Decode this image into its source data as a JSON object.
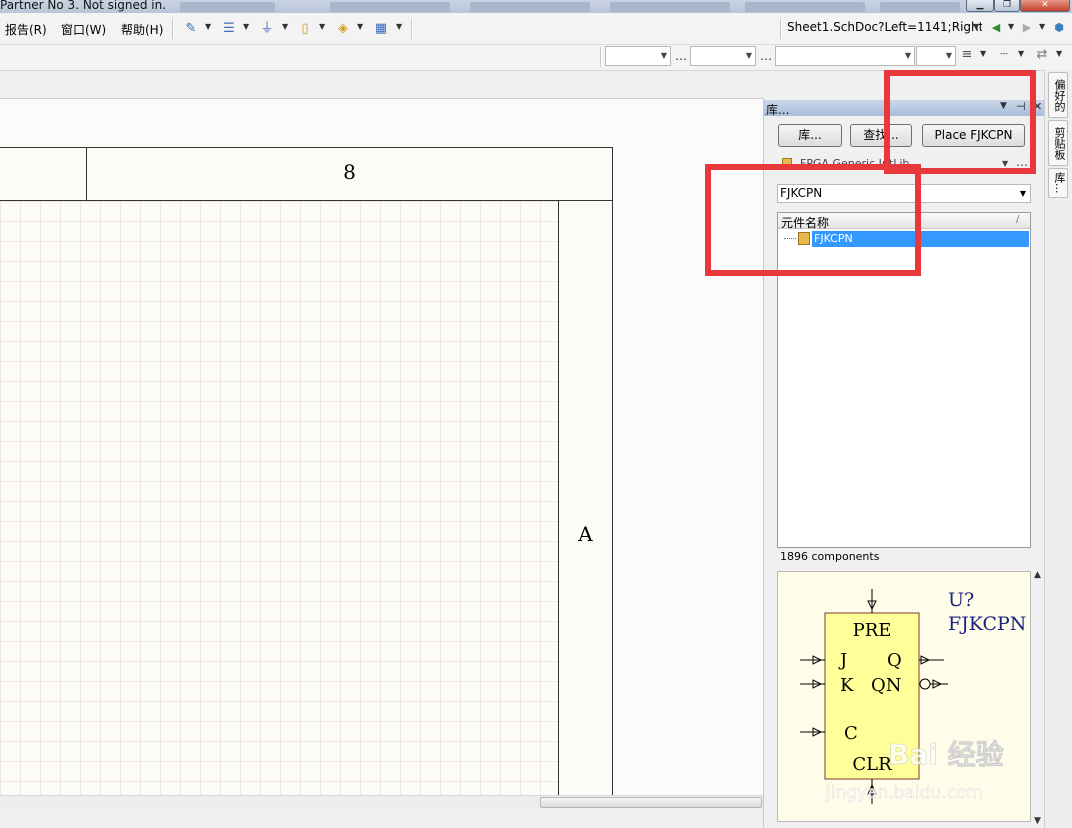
{
  "titlebar": {
    "text": "Partner No 3. Not signed in."
  },
  "menu": {
    "items": [
      {
        "label": "报告(R)"
      },
      {
        "label": "窗口(W)"
      },
      {
        "label": "帮助(H)"
      }
    ]
  },
  "toolbar": {
    "icons": [
      "wire-icon",
      "bus-icon",
      "ground-icon",
      "port-icon",
      "net-label-icon",
      "grid-icon"
    ],
    "document_address": "Sheet1.SchDoc?Left=1141;Right"
  },
  "canvas": {
    "zone_column_label": "8",
    "zone_row_label": "A"
  },
  "library_panel": {
    "title": "库...",
    "buttons": {
      "libraries": "库...",
      "search": "查找...",
      "place": "Place FJKCPN"
    },
    "library_name": "FPGA Generic.IntLib",
    "filter_value": "FJKCPN",
    "list_header": "元件名称",
    "sort_indicator": "/",
    "components": [
      {
        "name": "FJKCPN",
        "selected": true
      }
    ],
    "component_count": "1896 components"
  },
  "preview": {
    "designator": "U?",
    "comment": "FJKCPN",
    "pins": {
      "top": "PRE",
      "left": [
        "J",
        "K",
        "C"
      ],
      "right": [
        "Q",
        "QN"
      ],
      "bottom": "CLR"
    },
    "watermark": "Bai 经验",
    "watermark_url": "jingyan.baidu.com"
  },
  "dock_tabs": [
    "偏好的",
    "剪贴板",
    "库..."
  ],
  "colors": {
    "selection": "#3399ff",
    "annotation": "#e8383b",
    "component_fill": "#ffff99",
    "preview_text": "#1a237e"
  }
}
